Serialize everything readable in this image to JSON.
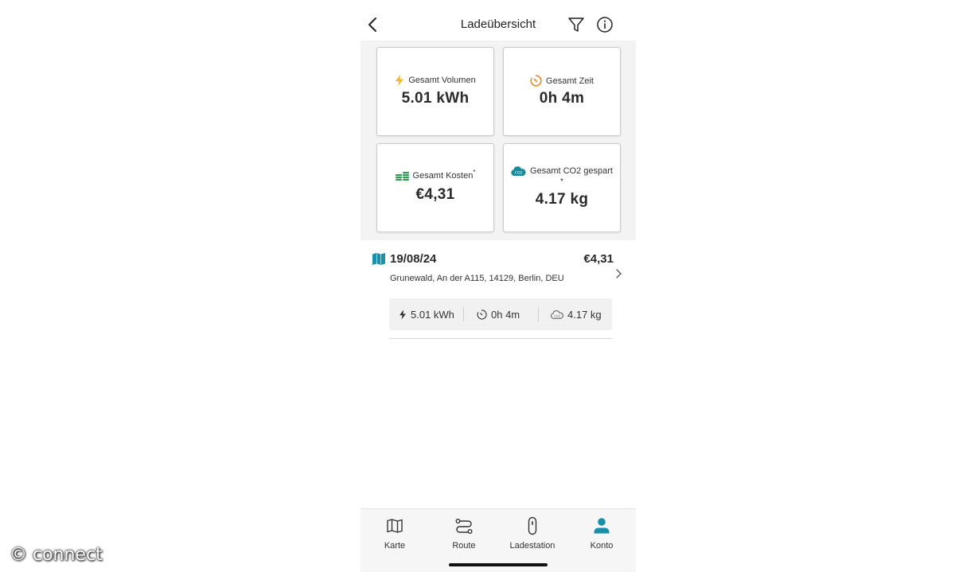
{
  "header": {
    "title": "Ladeübersicht"
  },
  "summary": {
    "volume": {
      "label": "Gesamt Volumen",
      "value": "5.01 kWh",
      "icon": "lightning-icon",
      "color": "#f2b81e"
    },
    "time": {
      "label": "Gesamt Zeit",
      "value": "0h 4m",
      "icon": "timer-icon",
      "color": "#ee8a1f"
    },
    "cost": {
      "label": "Gesamt Kosten",
      "marker": "*",
      "value": "€4,31",
      "icon": "coins-icon",
      "color": "#2e9a52"
    },
    "co2": {
      "label": "Gesamt CO2 gespart",
      "marker": "*",
      "value": "4.17 kg",
      "icon": "co2-cloud-icon",
      "color": "#1a8a9a"
    }
  },
  "session": {
    "date": "19/08/24",
    "price": "€4,31",
    "address": "Grunewald, An der A115, 14129, Berlin, DEU",
    "stats": {
      "volume": "5.01 kWh",
      "time": "0h 4m",
      "co2": "4.17 kg"
    }
  },
  "tabs": [
    {
      "label": "Karte",
      "icon": "map-icon"
    },
    {
      "label": "Route",
      "icon": "route-icon"
    },
    {
      "label": "Ladestation",
      "icon": "charger-icon"
    },
    {
      "label": "Konto",
      "icon": "person-icon",
      "active": true,
      "color": "#1a8fa6"
    }
  ],
  "watermark": "© connect"
}
